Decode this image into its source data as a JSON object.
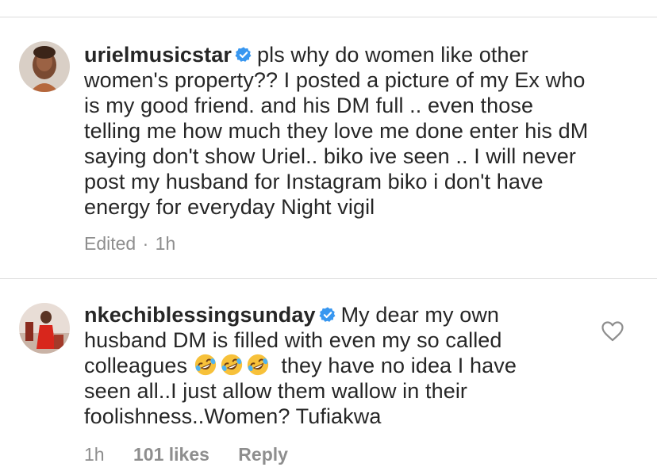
{
  "comments": [
    {
      "username": "urielmusicstar",
      "verified": true,
      "lines": [
        "pls why do women like other",
        "women's property?? I posted a picture of my Ex who",
        "is my good friend.  and his DM full .. even those",
        "telling me how much they love me done enter his dM",
        "saying don't show Uriel.. biko ive seen .. I will never",
        "post my husband for Instagram biko i don't have",
        "energy for everyday Night vigil"
      ],
      "meta": {
        "edited_label": "Edited",
        "separator": "·",
        "time": "1h"
      }
    },
    {
      "username": "nkechiblessingsunday",
      "verified": true,
      "lines": [
        "My dear my own",
        "husband DM is filled with even my so called",
        "colleagues",
        "they have no idea I have",
        "seen all..I just allow them wallow in their",
        "foolishness..Women? Tufiakwa"
      ],
      "meta": {
        "time": "1h",
        "likes": "101 likes",
        "reply": "Reply"
      },
      "icons": [
        "rolling-on-floor-laughing-emoji",
        "rolling-on-floor-laughing-emoji",
        "rolling-on-floor-laughing-emoji",
        "heart-outline-icon"
      ]
    }
  ],
  "colors": {
    "text": "#262626",
    "meta": "#8e8e8e",
    "verified": "#3897f0",
    "divider": "#dbdbdb"
  }
}
